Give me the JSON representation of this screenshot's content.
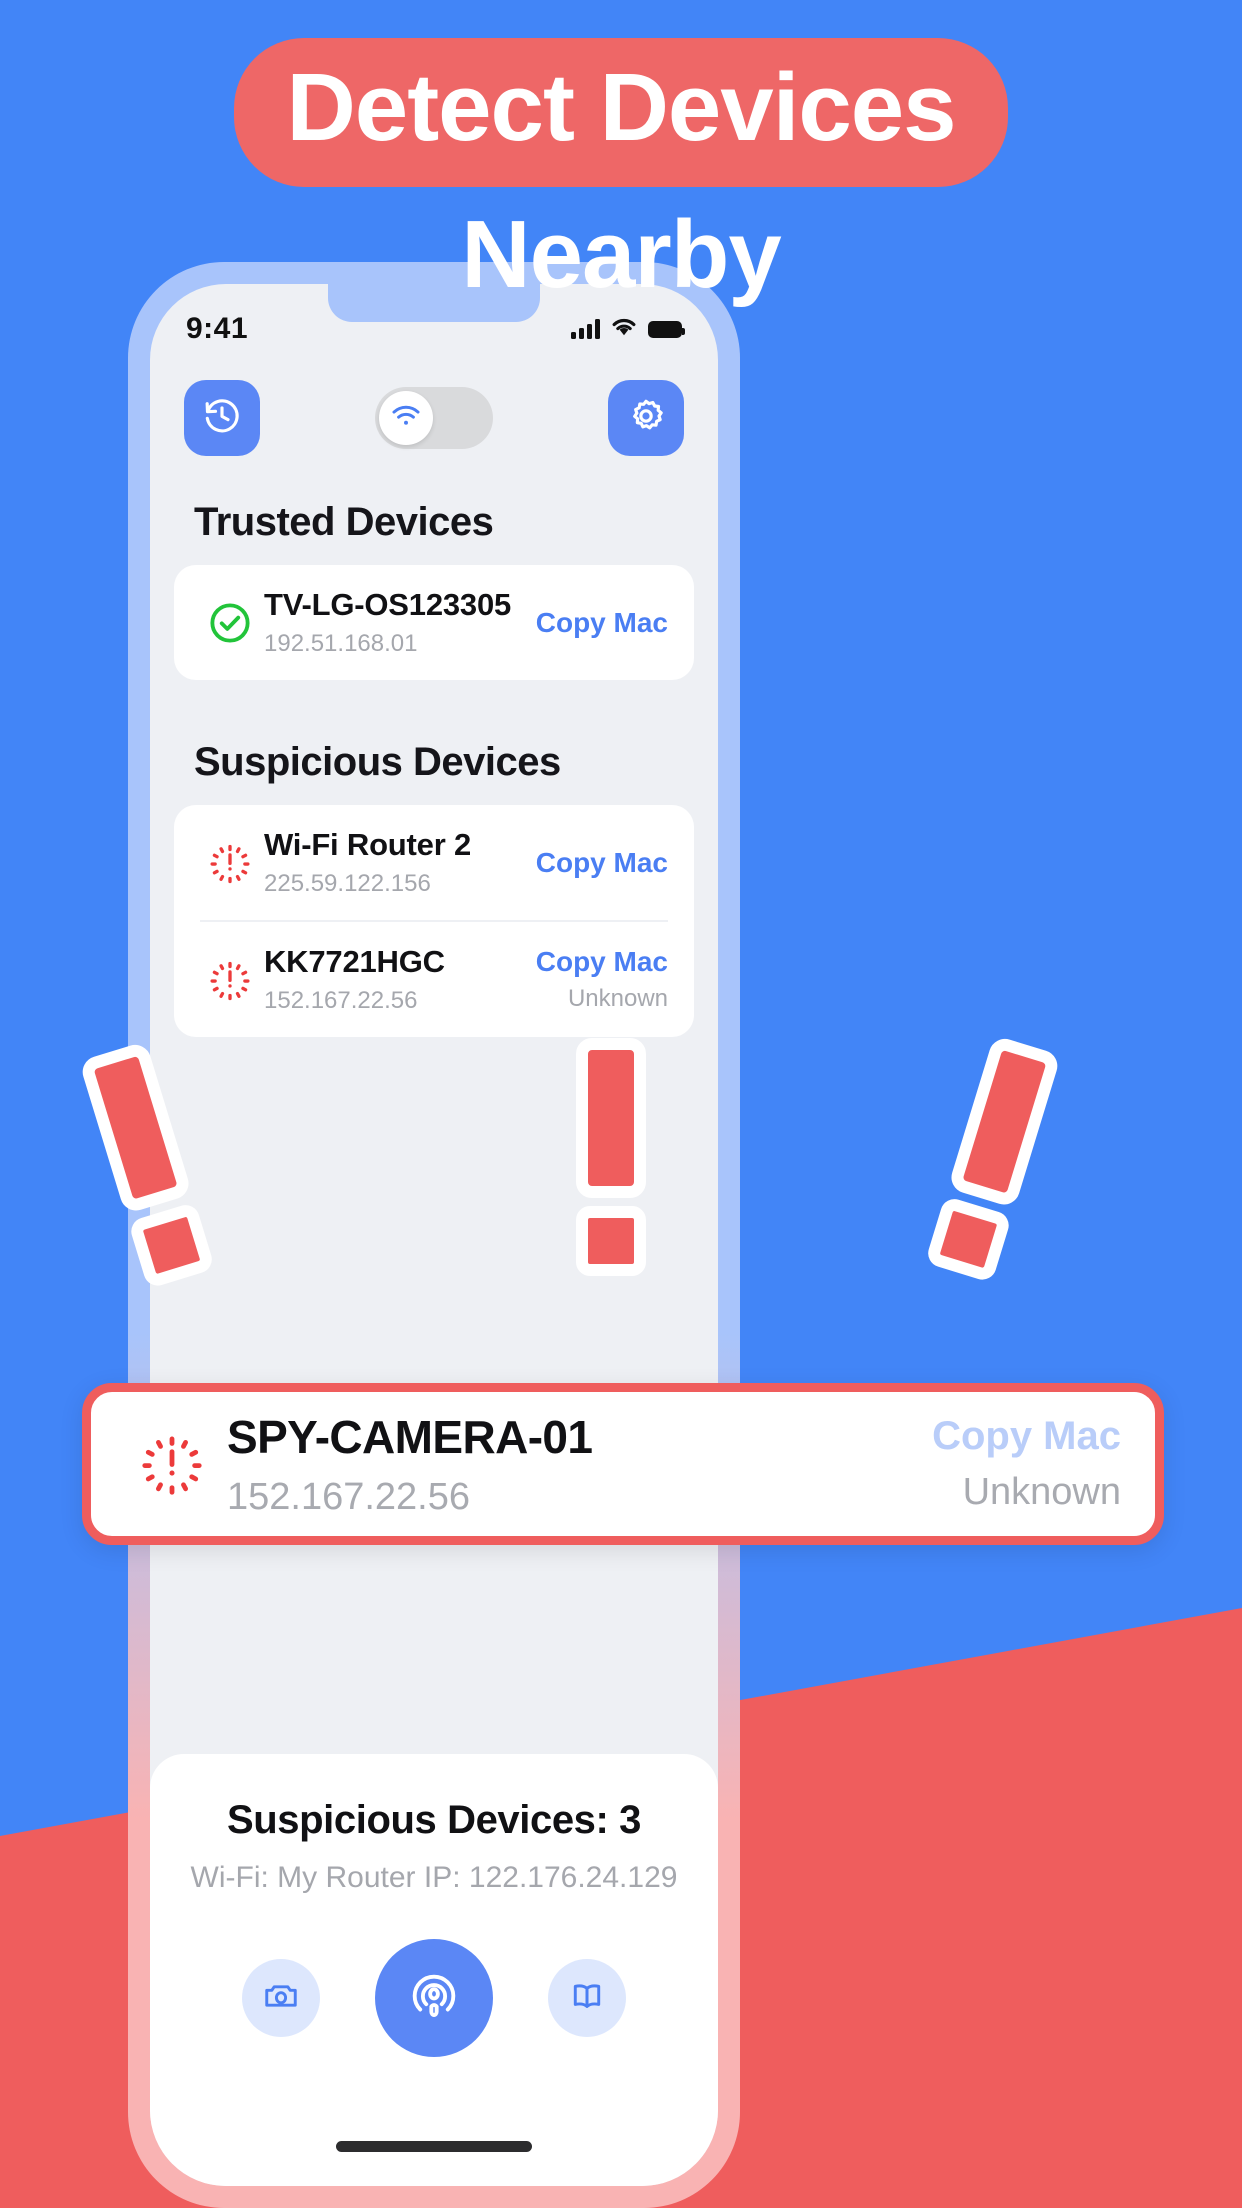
{
  "headline": {
    "line1": "Detect Devices",
    "line2": "Nearby",
    "pill_color": "#ee6767",
    "bg_color": "#4285f7",
    "accent_red": "#ef5d5d"
  },
  "status_bar": {
    "time": "9:41",
    "signal_icon": "cellular-signal-icon",
    "wifi_icon": "wifi-icon",
    "battery_icon": "battery-full-icon"
  },
  "toolbar": {
    "history_button": "history-icon",
    "wifi_toggle": {
      "icon": "wifi-icon",
      "state": "on"
    },
    "settings_button": "gear-icon"
  },
  "sections": {
    "trusted": {
      "title": "Trusted Devices",
      "devices": [
        {
          "icon": "check-circle-icon",
          "name": "TV-LG-OS123305",
          "ip": "192.51.168.01",
          "action": "Copy Mac",
          "status": ""
        }
      ]
    },
    "suspicious": {
      "title": "Suspicious Devices",
      "devices": [
        {
          "icon": "alert-radar-icon",
          "name": "Wi-Fi Router 2",
          "ip": "225.59.122.156",
          "action": "Copy Mac",
          "status": ""
        },
        {
          "icon": "alert-radar-icon",
          "name": "KK7721HGC",
          "ip": "152.167.22.56",
          "action": "Copy Mac",
          "status": "Unknown"
        }
      ]
    }
  },
  "spy_callout": {
    "icon": "alert-radar-icon",
    "name": "SPY-CAMERA-01",
    "ip": "152.167.22.56",
    "action": "Copy Mac",
    "status": "Unknown",
    "border_color": "#ef5d5d"
  },
  "summary": {
    "title": "Suspicious Devices: 3",
    "subtitle": "Wi-Fi: My Router   IP: 122.176.24.129"
  },
  "navbar": {
    "items": [
      {
        "icon": "camera-icon",
        "active": false
      },
      {
        "icon": "radar-detect-icon",
        "active": true
      },
      {
        "icon": "book-icon",
        "active": false
      }
    ]
  },
  "decorations": {
    "exclamation_marks": 3
  }
}
